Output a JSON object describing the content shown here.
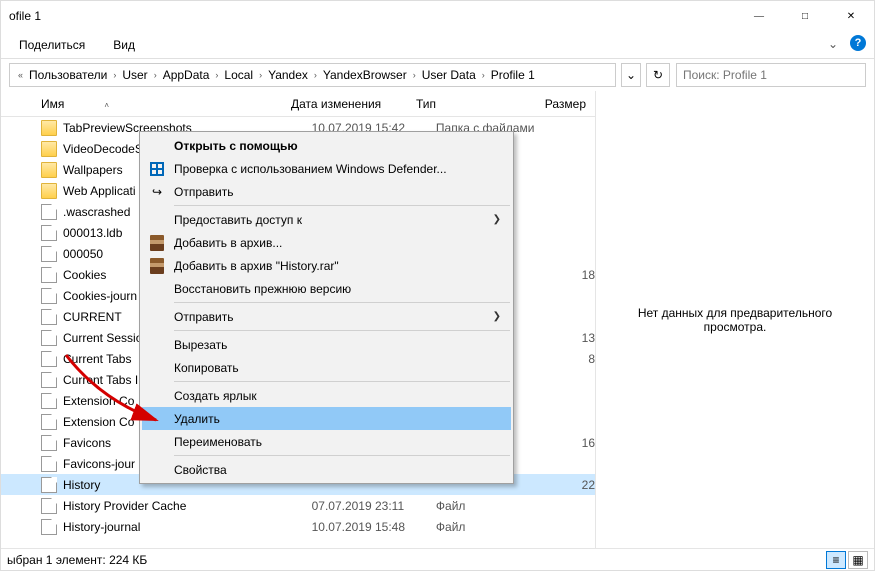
{
  "window": {
    "title": "ofile 1"
  },
  "ribbon": {
    "share": "Поделиться",
    "view": "Вид"
  },
  "breadcrumbs": {
    "items": [
      "Пользователи",
      "User",
      "AppData",
      "Local",
      "Yandex",
      "YandexBrowser",
      "User Data",
      "Profile 1"
    ]
  },
  "search": {
    "placeholder": "Поиск: Profile 1"
  },
  "columns": {
    "name": "Имя",
    "date": "Дата изменения",
    "type": "Тип",
    "size": "Размер"
  },
  "rows": [
    {
      "icon": "folder",
      "name": "TabPreviewScreenshots",
      "date": "10.07.2019 15:42",
      "type": "Папка с файлами",
      "size": ""
    },
    {
      "icon": "folder",
      "name": "VideoDecodeS",
      "date": "",
      "type": "",
      "size": ""
    },
    {
      "icon": "folder",
      "name": "Wallpapers",
      "date": "",
      "type": "",
      "size": ""
    },
    {
      "icon": "folder",
      "name": "Web Applicati",
      "date": "",
      "type": "",
      "size": ""
    },
    {
      "icon": "file",
      "name": ".wascrashed",
      "date": "",
      "type": "",
      "size": ""
    },
    {
      "icon": "file",
      "name": "000013.ldb",
      "date": "",
      "type": "",
      "size": ""
    },
    {
      "icon": "file",
      "name": "000050",
      "date": "",
      "type": "",
      "size": ""
    },
    {
      "icon": "file",
      "name": "Cookies",
      "date": "",
      "type": "",
      "size": "18"
    },
    {
      "icon": "file",
      "name": "Cookies-journ",
      "date": "",
      "type": "",
      "size": ""
    },
    {
      "icon": "file",
      "name": "CURRENT",
      "date": "",
      "type": "",
      "size": ""
    },
    {
      "icon": "file",
      "name": "Current Sessio",
      "date": "",
      "type": "",
      "size": "13"
    },
    {
      "icon": "file",
      "name": "Current Tabs",
      "date": "",
      "type": "",
      "size": "8"
    },
    {
      "icon": "file",
      "name": "Current Tabs I",
      "date": "",
      "type": "",
      "size": ""
    },
    {
      "icon": "file",
      "name": "Extension Co",
      "date": "",
      "type": "",
      "size": ""
    },
    {
      "icon": "file",
      "name": "Extension Co",
      "date": "",
      "type": "",
      "size": ""
    },
    {
      "icon": "file",
      "name": "Favicons",
      "date": "",
      "type": "",
      "size": "16"
    },
    {
      "icon": "file",
      "name": "Favicons-jour",
      "date": "",
      "type": "",
      "size": ""
    },
    {
      "icon": "file",
      "name": "History",
      "date": "",
      "type": "",
      "size": "22",
      "selected": true
    },
    {
      "icon": "file",
      "name": "History Provider Cache",
      "date": "07.07.2019 23:11",
      "type": "Файл",
      "size": ""
    },
    {
      "icon": "file",
      "name": "History-journal",
      "date": "10.07.2019 15:48",
      "type": "Файл",
      "size": ""
    }
  ],
  "context": {
    "open_with": "Открыть с помощью",
    "defender": "Проверка с использованием Windows Defender...",
    "send": "Отправить",
    "share_access": "Предоставить доступ к",
    "add_archive": "Добавить в архив...",
    "add_history_rar": "Добавить в архив \"History.rar\"",
    "restore": "Восстановить прежнюю версию",
    "send2": "Отправить",
    "cut": "Вырезать",
    "copy": "Копировать",
    "shortcut": "Создать ярлык",
    "delete": "Удалить",
    "rename": "Переименовать",
    "properties": "Свойства"
  },
  "preview": {
    "empty": "Нет данных для предварительного просмотра."
  },
  "status": {
    "text": "ыбран 1 элемент: 224 КБ"
  }
}
